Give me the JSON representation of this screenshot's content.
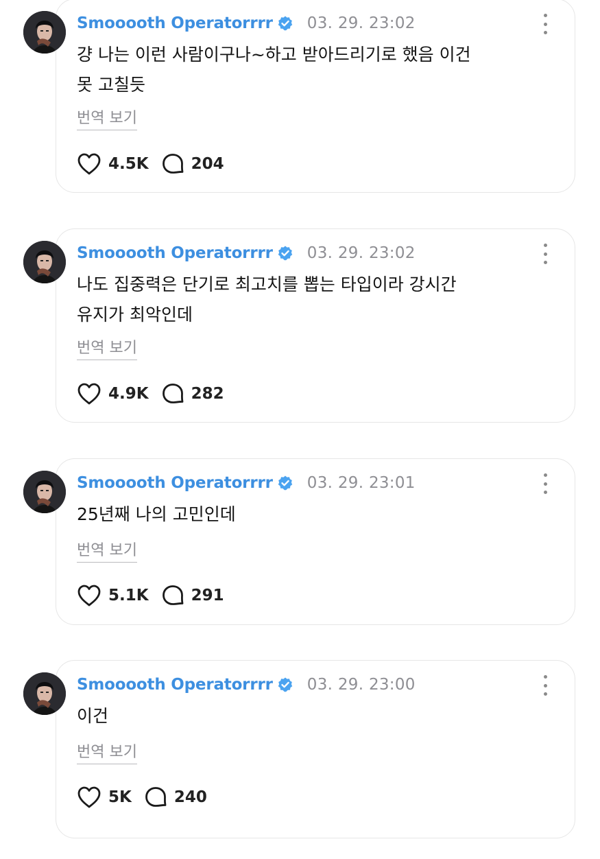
{
  "colors": {
    "username": "#3d8fe0",
    "verified_badge": "#4ba3f0",
    "timestamp": "#8e8e93",
    "card_border": "#e6e6e6"
  },
  "icons": {
    "verified": "verified-badge-icon",
    "more": "more-vertical-icon",
    "like": "heart-icon",
    "reply": "comment-bubble-icon"
  },
  "posts": [
    {
      "username": "Smooooth Operatorrrr",
      "timestamp": "03. 29. 23:02",
      "text": "걍 나는 이런 사람이구나~하고 받아드리기로 했음 이건\n못 고칠듯",
      "translate_label": "번역 보기",
      "likes": "4.5K",
      "replies": "204"
    },
    {
      "username": "Smooooth Operatorrrr",
      "timestamp": "03. 29. 23:02",
      "text": "나도 집중력은 단기로 최고치를 뽑는 타입이라 강시간\n유지가 최악인데",
      "translate_label": "번역 보기",
      "likes": "4.9K",
      "replies": "282"
    },
    {
      "username": "Smooooth Operatorrrr",
      "timestamp": "03. 29. 23:01",
      "text": "25년째 나의 고민인데",
      "translate_label": "번역 보기",
      "likes": "5.1K",
      "replies": "291"
    },
    {
      "username": "Smooooth Operatorrrr",
      "timestamp": "03. 29. 23:00",
      "text": "이건",
      "translate_label": "번역 보기",
      "likes": "5K",
      "replies": "240"
    }
  ]
}
